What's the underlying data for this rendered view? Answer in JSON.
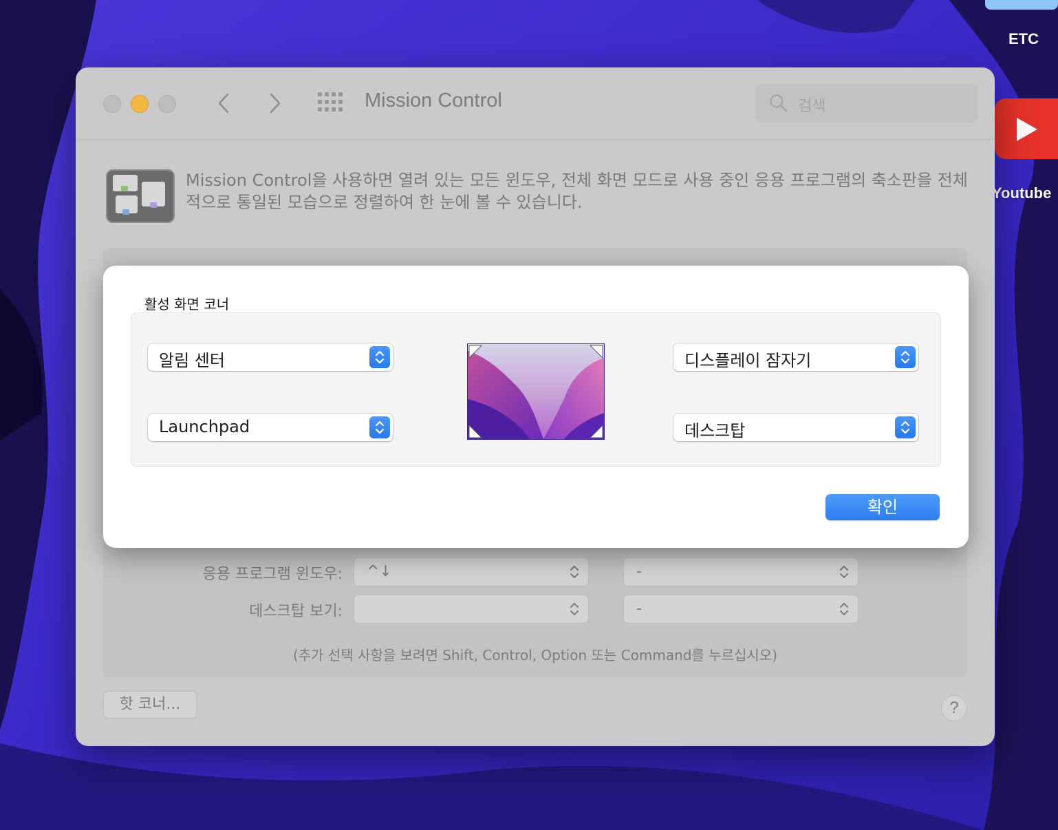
{
  "desktop": {
    "etc_label": "ETC",
    "youtube_label": "Youtube"
  },
  "window": {
    "title": "Mission Control",
    "search_placeholder": "검색",
    "description": "Mission Control을 사용하면 열려 있는 모든 윈도우, 전체 화면 모드로 사용 중인 응용 프로그램의 축소판을 전체적으로 통일된 모습으로 정렬하여 한 눈에 볼 수 있습니다.",
    "shortcuts": {
      "app_windows_label": "응용 프로그램 윈도우:",
      "app_windows_key": "^↓",
      "app_windows_mouse": "-",
      "show_desktop_label": "데스크탑 보기:",
      "show_desktop_key": "",
      "show_desktop_mouse": "-"
    },
    "hint": "(추가 선택 사항을 보려면 Shift, Control, Option 또는 Command를 누르십시오)",
    "hot_corners_button": "핫 코너...",
    "help_button": "?"
  },
  "sheet": {
    "title": "활성 화면 코너",
    "corners": {
      "top_left": "알림 센터",
      "bottom_left": "Launchpad",
      "top_right": "디스플레이 잠자기",
      "bottom_right": "데스크탑"
    },
    "ok_button": "확인"
  },
  "colors": {
    "accent": "#2f7df0",
    "window_bg": "#cacacc",
    "minimize": "#f2b843",
    "youtube": "#e8322a"
  }
}
